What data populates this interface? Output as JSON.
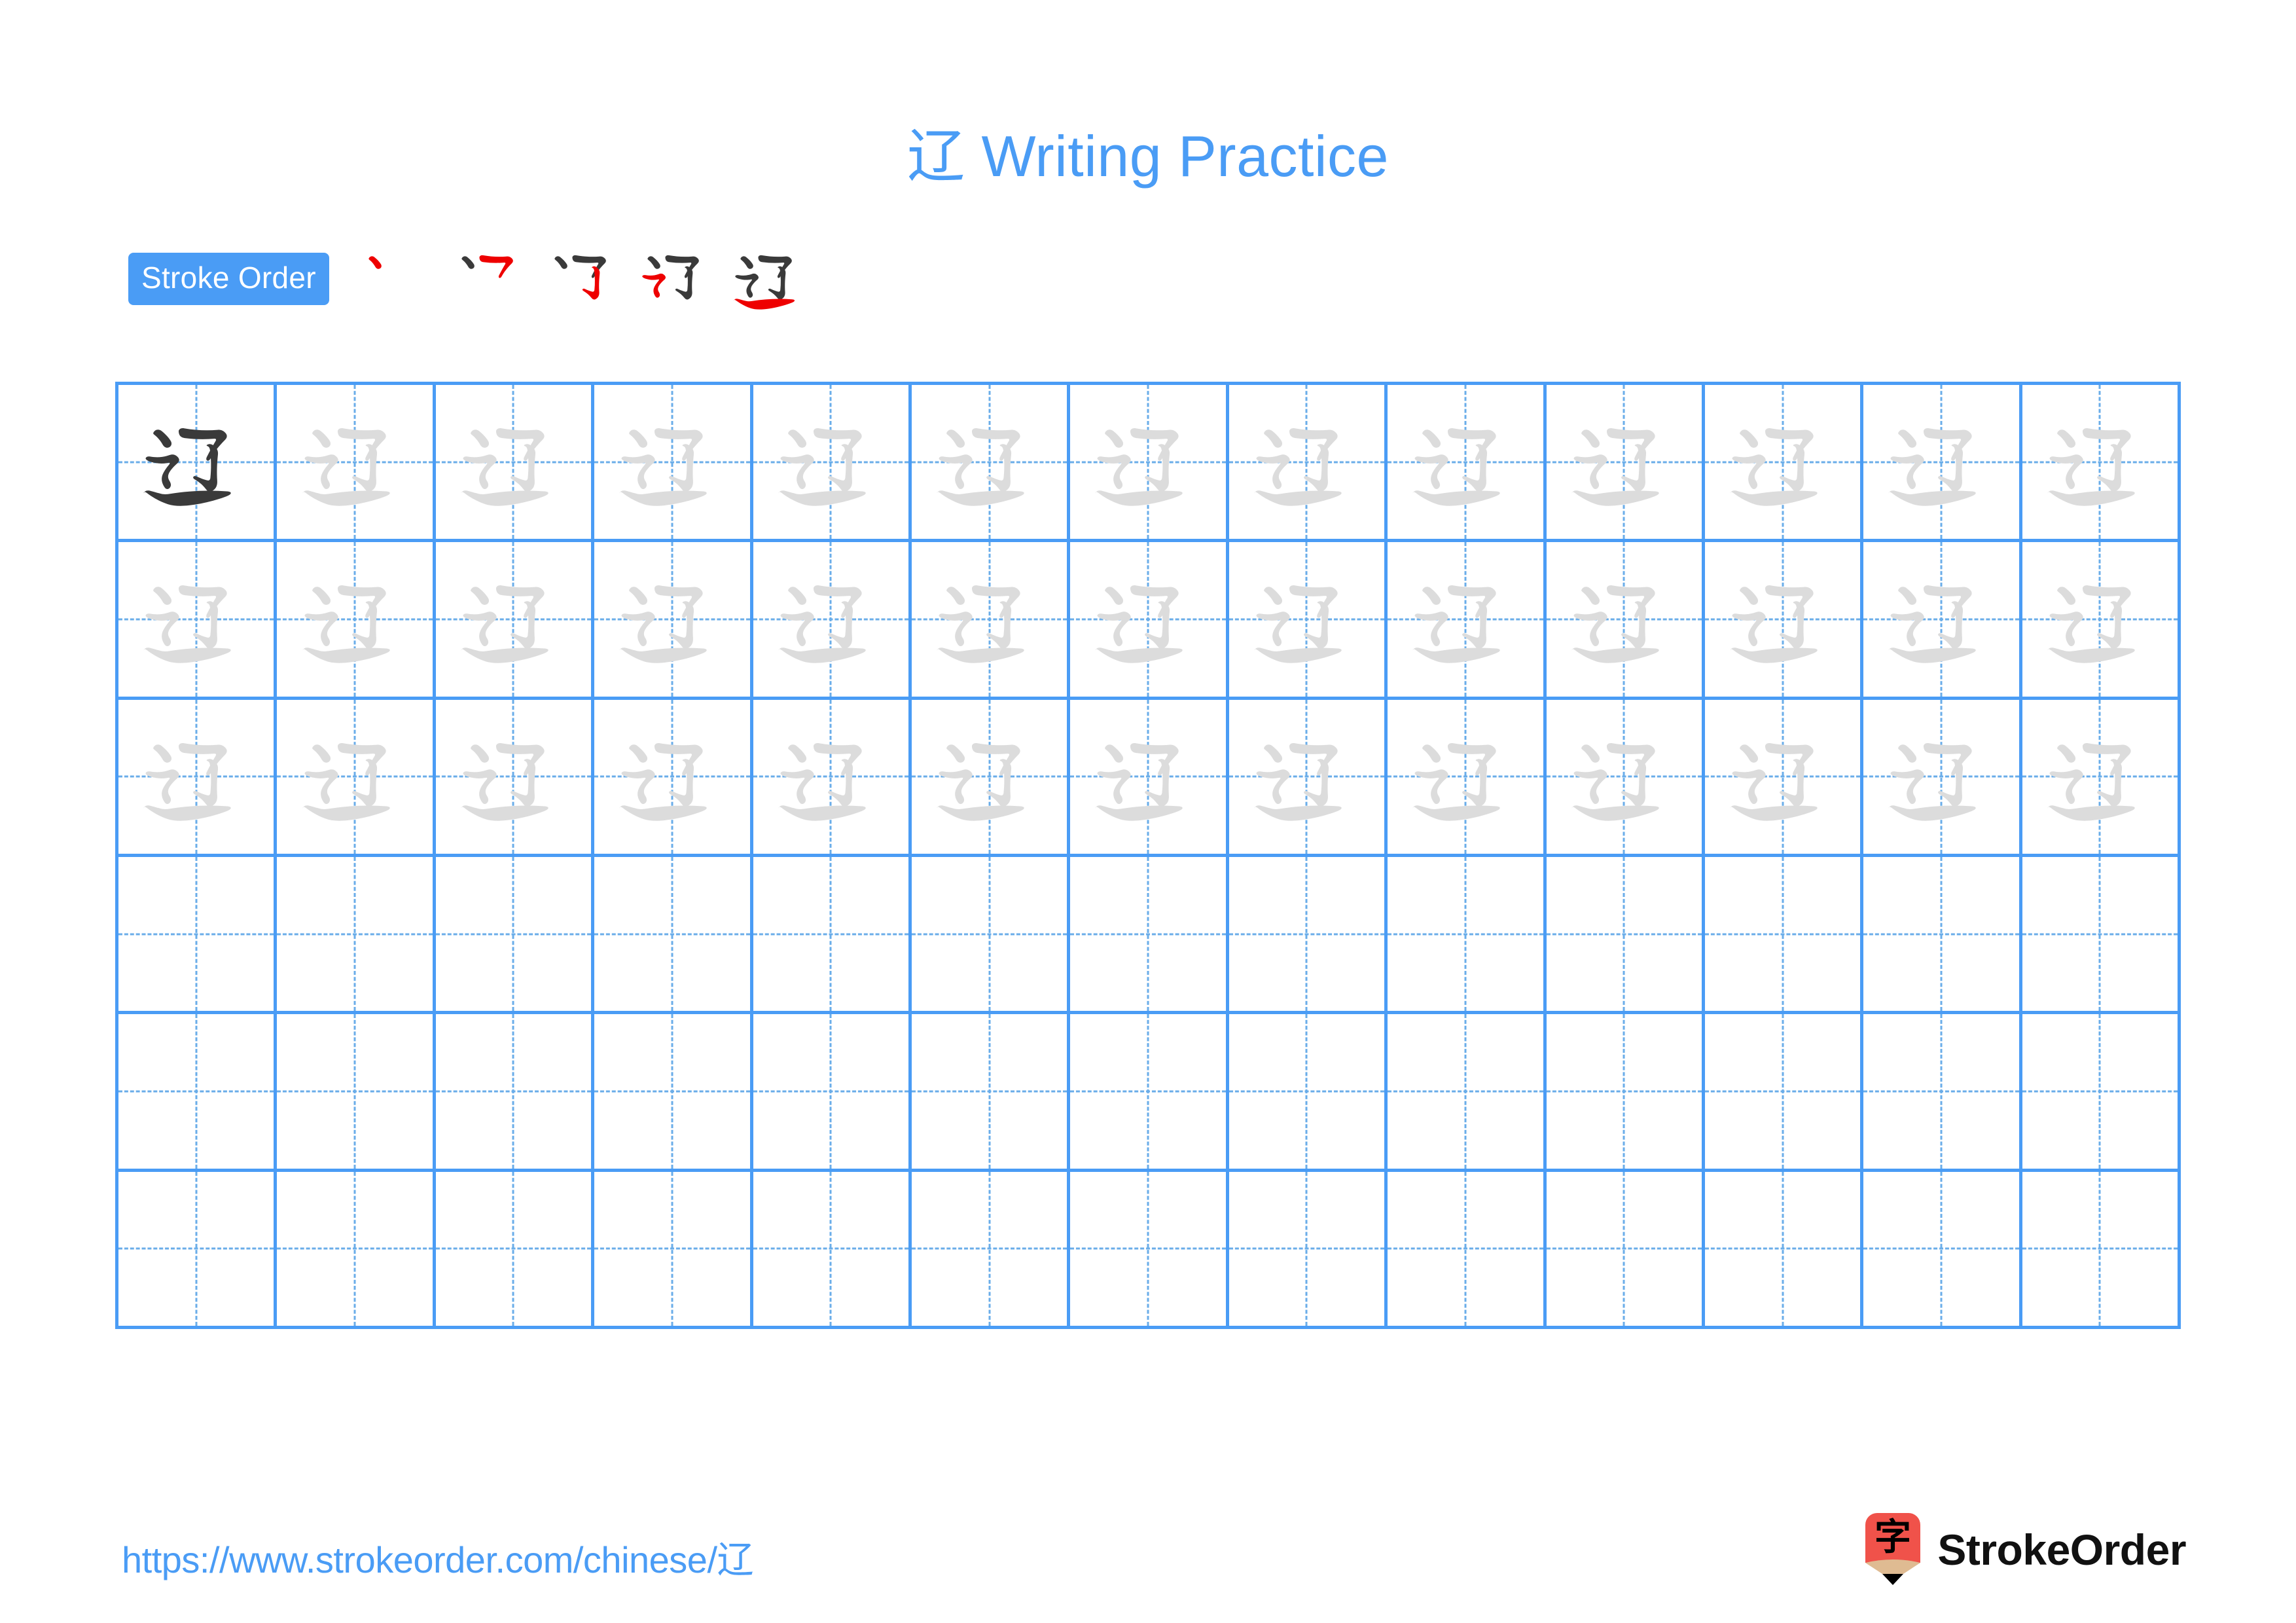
{
  "character": "辽",
  "header": {
    "title_prefix": "辽",
    "title_text": " Writing Practice",
    "title_full": "辽 Writing Practice",
    "title_color": "#4a9cf5"
  },
  "stroke_order": {
    "badge_label": "Stroke Order",
    "badge_bg": "#4a9cf5",
    "badge_text_color": "#ffffff",
    "new_stroke_color": "#ee0000",
    "done_stroke_color": "#3a3a3a",
    "step_count": 5,
    "steps": [
      {
        "index": 1,
        "strokes_done": 0,
        "new_stroke": 1,
        "label": "stroke-1"
      },
      {
        "index": 2,
        "strokes_done": 1,
        "new_stroke": 2,
        "label": "stroke-2"
      },
      {
        "index": 3,
        "strokes_done": 2,
        "new_stroke": 3,
        "label": "stroke-3"
      },
      {
        "index": 4,
        "strokes_done": 3,
        "new_stroke": 4,
        "label": "stroke-4"
      },
      {
        "index": 5,
        "strokes_done": 4,
        "new_stroke": 5,
        "label": "stroke-5"
      }
    ]
  },
  "grid": {
    "columns": 13,
    "rows": 6,
    "line_color": "#4a9cf5",
    "guide_color": "#6aade9",
    "model_glyph_color": "#3a3a3a",
    "trace_glyph_color": "#dcdcdc",
    "row_fill": [
      "model-then-trace",
      "trace",
      "trace",
      "empty",
      "empty",
      "empty"
    ]
  },
  "footer": {
    "url": "https://www.strokeorder.com/chinese/辽",
    "url_color": "#4a9cf5",
    "brand_name": "StrokeOrder",
    "brand_mark_character": "字",
    "brand_mark_colors": {
      "body": "#f0524a",
      "wood": "#dfbb92",
      "tip": "#000000"
    }
  }
}
